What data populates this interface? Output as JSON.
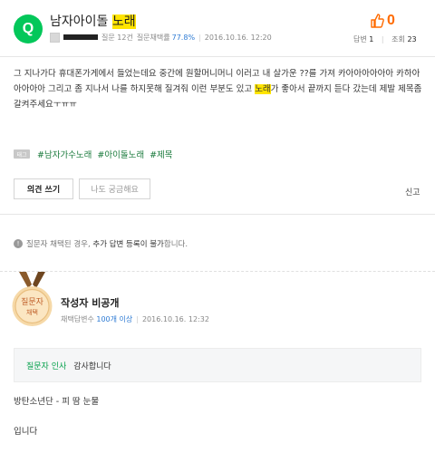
{
  "question": {
    "badge": "Q",
    "title_prefix": "남자아이돌 ",
    "title_highlight": "노래",
    "author_redacted": true,
    "questions_label": "질문 12건",
    "adopt_rate_label": "질문채택률",
    "adopt_rate_value": "77.8%",
    "date": "2016.10.16. 12:20",
    "likes": "0",
    "answers_label": "답변",
    "answers_count": "1",
    "views_label": "조회",
    "views_count": "23",
    "body_part1": "그 지나가다 휴대폰가게에서 들었는데요 중간에 원할머니머니 이러고 내 살가운 ??를 가져 카아아아아아아 카하아아아아아 그리고 좀 지나서 나를 하지못해 질겨줘 이런 부분도 있고 ",
    "body_highlight": "노래",
    "body_part2": "가 좋아서 끝까지 듣다 갔는데 제발 제목좀 갈켜주세요ㅜㅠㅠ",
    "tag_icon_label": "태그",
    "tags": [
      "#남자가수노래",
      "#아이돌노래",
      "#제목"
    ],
    "opinion_button": "의견 쓰기",
    "curious_button": "나도 궁금해요",
    "report_label": "신고"
  },
  "notice": {
    "part1": "질문자 채택된 경우, ",
    "bold": "추가 답변 등록이 불가",
    "part2": "합니다."
  },
  "answer": {
    "medal_line1": "질문자",
    "medal_line2": "채택",
    "author": "작성자 비공개",
    "meta_label": "채택답변수",
    "meta_value": "100개 이상",
    "date": "2016.10.16. 12:32",
    "greet_label": "질문자 인사",
    "greet_text": "감사합니다",
    "line1": "방탄소년단 - 피 땀 눈물",
    "line2": "입니다"
  },
  "colors": {
    "brand_green": "#03c75a",
    "highlight": "#ffe400",
    "like_orange": "#ff6b00",
    "tag_green": "#1a7a3c",
    "link_blue": "#2e7bd4"
  }
}
